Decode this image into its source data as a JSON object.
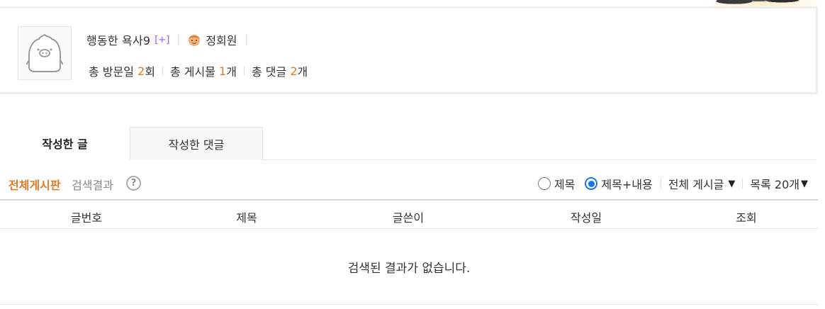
{
  "profile": {
    "nickname": "행동한 욕사9",
    "plus_badge": "[+]",
    "member_grade": "정회원",
    "stats": [
      {
        "label": "총 방문일",
        "value": "2",
        "unit": "회"
      },
      {
        "label": "총 게시물",
        "value": "1",
        "unit": "개"
      },
      {
        "label": "총 댓글",
        "value": "2",
        "unit": "개"
      }
    ]
  },
  "tabs": [
    {
      "label": "작성한 글",
      "active": true
    },
    {
      "label": "작성한 댓글",
      "active": false
    }
  ],
  "search": {
    "board_title": "전체게시판",
    "board_subtitle": "검색결과",
    "help_icon": "?",
    "radio_options": [
      {
        "label": "제목",
        "checked": false
      },
      {
        "label": "제목+내용",
        "checked": true
      }
    ],
    "post_filter": "전체 게시글",
    "list_size": "목록 20개"
  },
  "table": {
    "columns": [
      "글번호",
      "제목",
      "글쓴이",
      "작성일",
      "조회"
    ],
    "empty_message": "검색된 결과가 없습니다."
  },
  "colors": {
    "accent": "#e07b25",
    "radio_selected": "#1a73e8",
    "plus_badge": "#8a5fe8"
  }
}
